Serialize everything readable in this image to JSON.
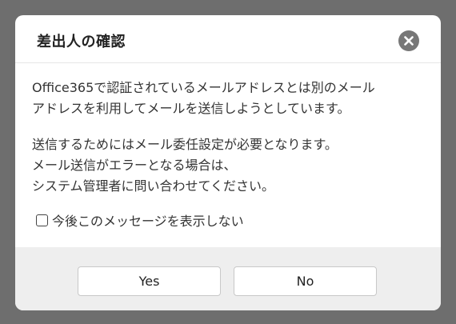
{
  "dialog": {
    "title": "差出人の確認",
    "close_icon": "close-icon",
    "message1_line1": "Office365で認証されているメールアドレスとは別のメール",
    "message1_line2": "アドレスを利用してメールを送信しようとしています。",
    "message2_line1": "送信するためにはメール委任設定が必要となります。",
    "message2_line2": "メール送信がエラーとなる場合は、",
    "message2_line3": "システム管理者に問い合わせてください。",
    "checkbox_label": "今後このメッセージを表示しない",
    "yes_label": "Yes",
    "no_label": "No"
  },
  "colors": {
    "backdrop": "#6e6e6e",
    "footer": "#eeeeee",
    "close_button": "#777777"
  }
}
